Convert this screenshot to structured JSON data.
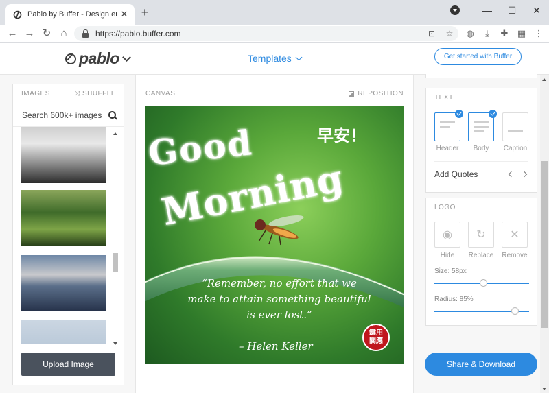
{
  "browser": {
    "tab_title": "Pablo by Buffer - Design engag",
    "close_glyph": "✕",
    "newtab_glyph": "+",
    "url": "https://pablo.buffer.com",
    "window_buttons": [
      "—",
      "☐",
      "✕"
    ],
    "nav_icons": [
      "back-icon",
      "forward-icon",
      "reload-icon",
      "home-icon"
    ],
    "extension_icons": [
      "translate-icon",
      "star-icon",
      "extension-globe-icon",
      "download-icon",
      "puzzle-icon",
      "profile-screenshot-icon",
      "menu-icon"
    ]
  },
  "header": {
    "logo_text": "pablo",
    "templates_label": "Templates",
    "get_started_label": "Get started with Buffer",
    "accent_color": "#2d8ae0"
  },
  "images_panel": {
    "title": "IMAGES",
    "shuffle_label": "SHUFFLE",
    "search_placeholder": "Search 600k+ images",
    "upload_label": "Upload Image"
  },
  "canvas": {
    "label": "CANVAS",
    "reposition_label": "REPOSITION",
    "greeting_line1": "Good",
    "greeting_line2": "Morning",
    "chinese_text": "早安！",
    "quote": "“Remember, no effort that we make to attain something beautiful is ever lost.”",
    "author": "– Helen Keller",
    "seal_text": "鍵用\n關應"
  },
  "text_panel": {
    "title": "TEXT",
    "options": [
      {
        "label": "Header",
        "selected": true
      },
      {
        "label": "Body",
        "selected": true
      },
      {
        "label": "Caption",
        "selected": false
      }
    ],
    "add_quotes_label": "Add Quotes"
  },
  "logo_panel": {
    "title": "LOGO",
    "buttons": [
      {
        "label": "Hide",
        "icon": "eye-icon"
      },
      {
        "label": "Replace",
        "icon": "refresh-icon"
      },
      {
        "label": "Remove",
        "icon": "close-icon"
      }
    ],
    "size_label": "Size: 58px",
    "size_value_fraction": 0.52,
    "radius_label": "Radius: 85%",
    "radius_value_fraction": 0.85
  },
  "actions": {
    "share_label": "Share & Download"
  }
}
